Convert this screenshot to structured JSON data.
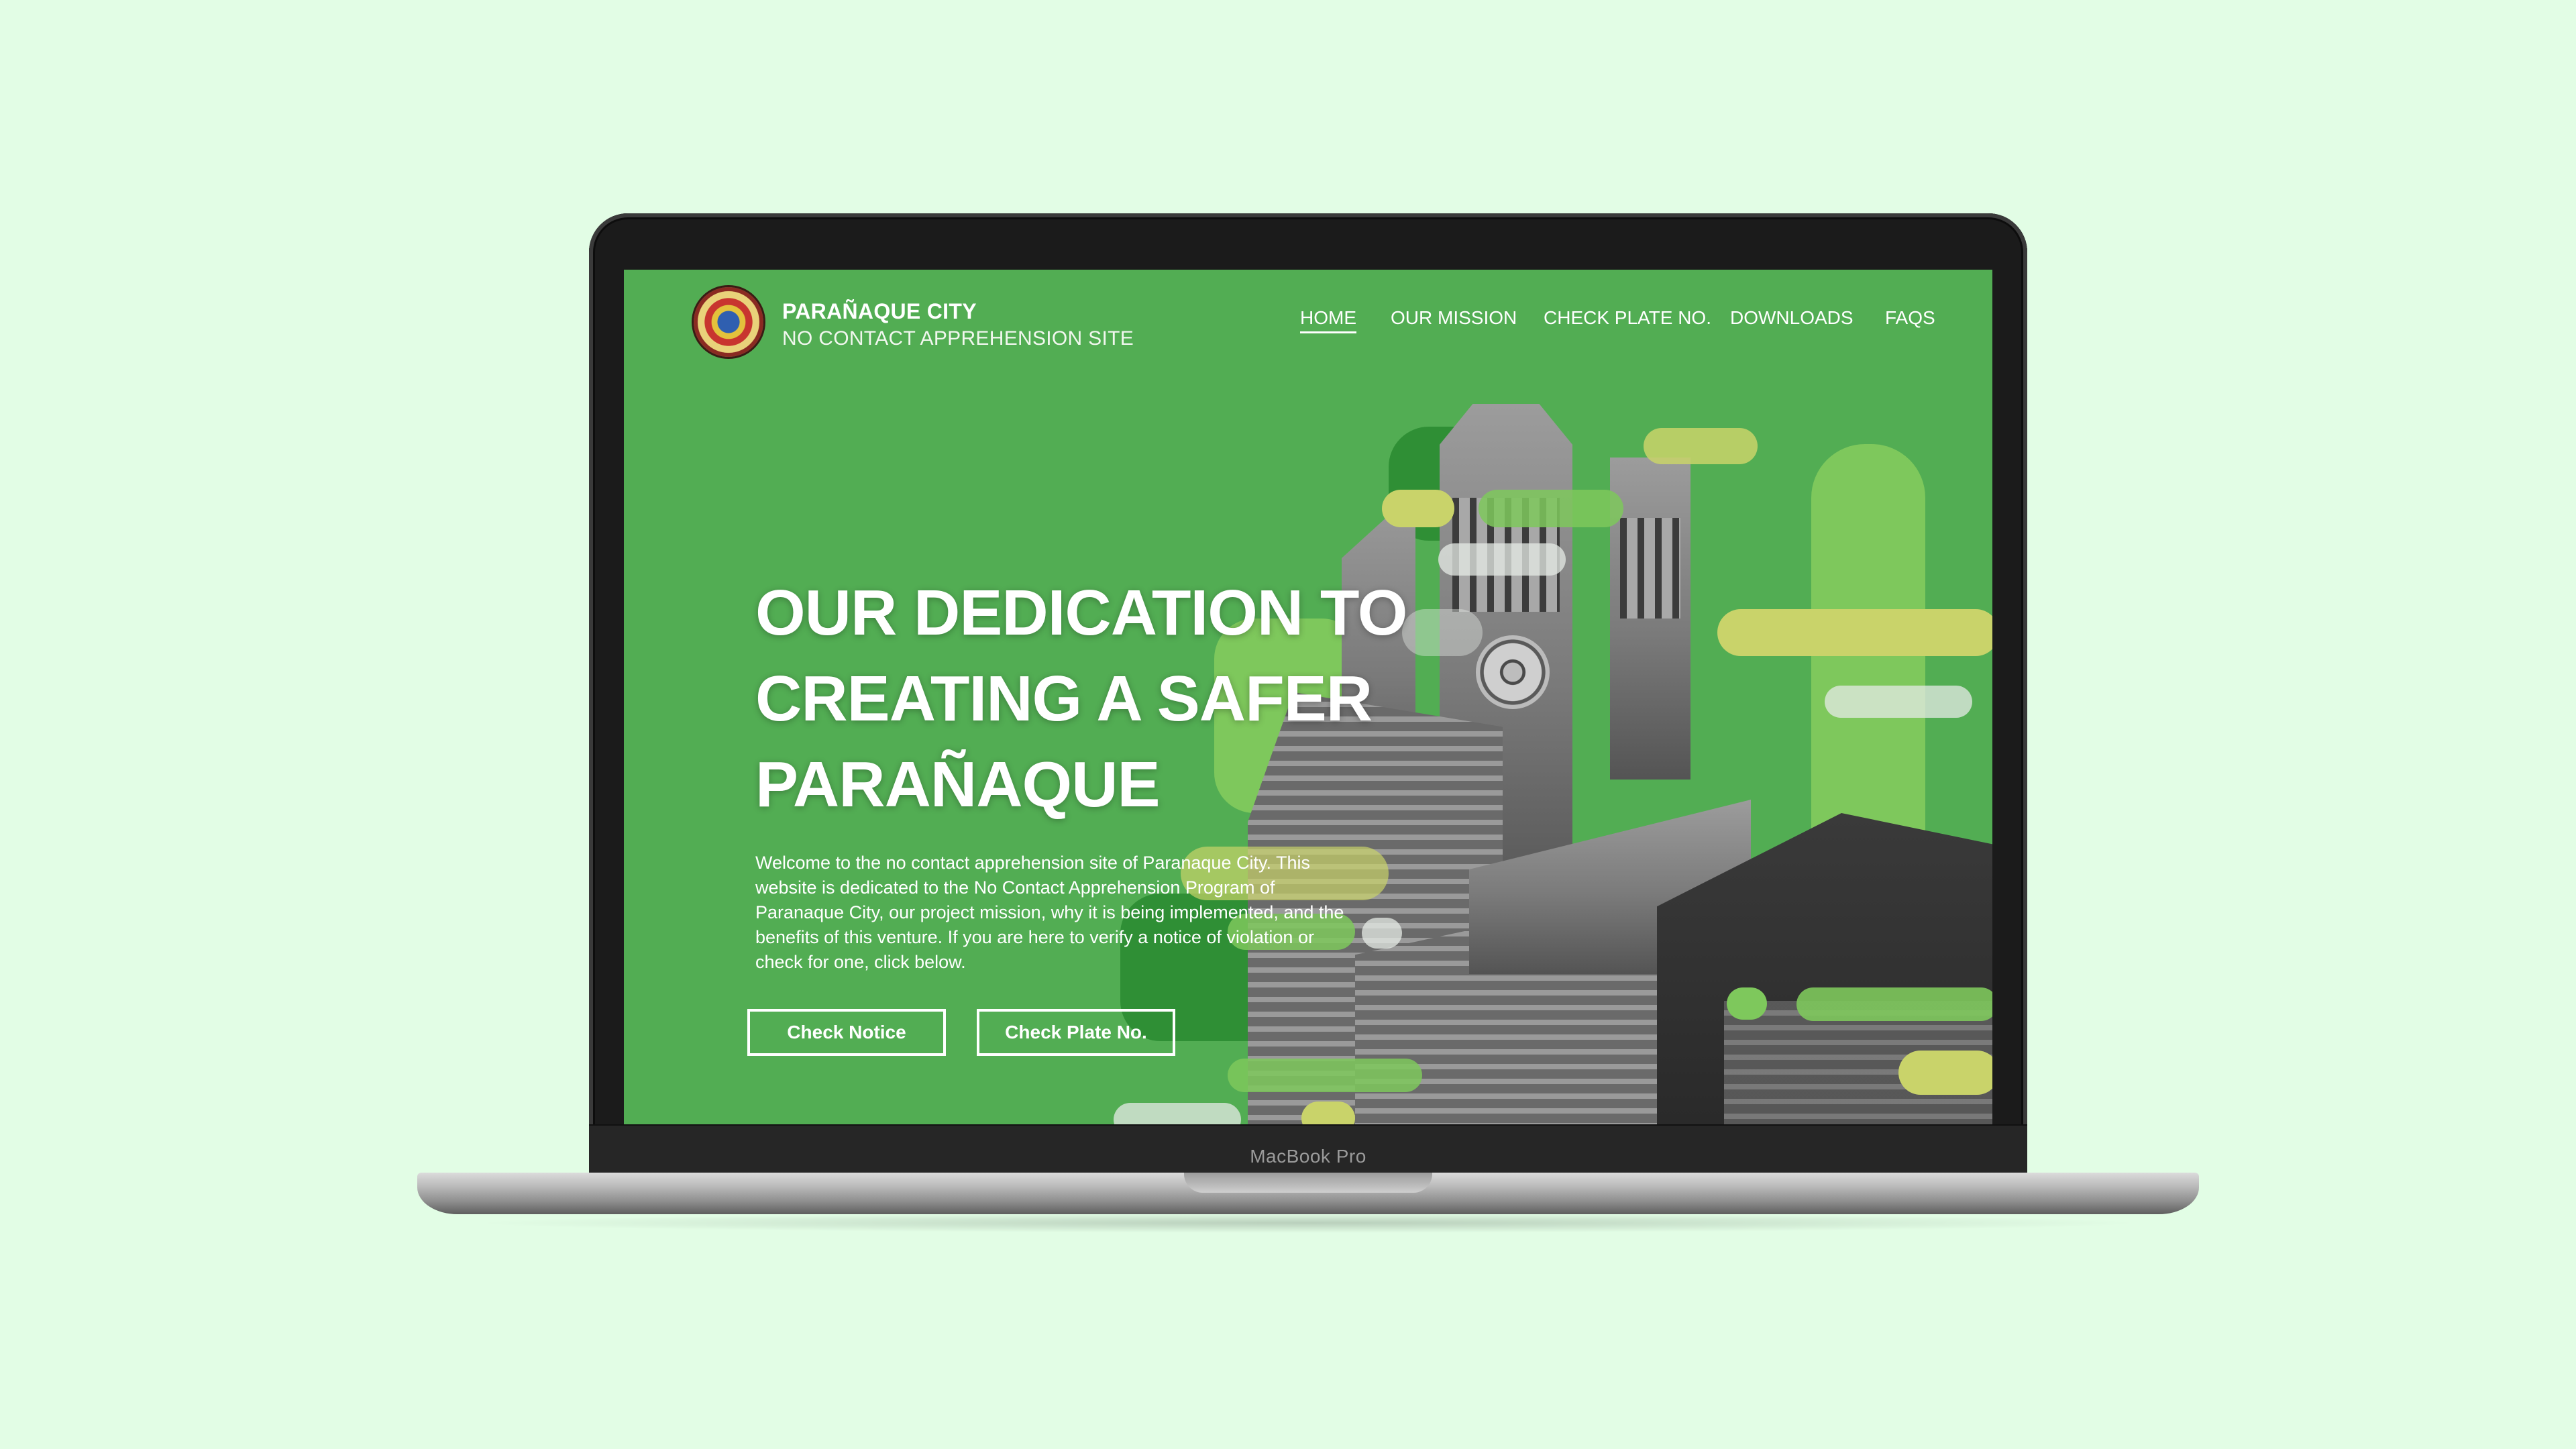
{
  "device": {
    "label": "MacBook Pro"
  },
  "header": {
    "title": "PARAÑAQUE CITY",
    "subtitle": "NO CONTACT APPREHENSION SITE",
    "nav": [
      {
        "label": "HOME",
        "active": true
      },
      {
        "label": "OUR MISSION",
        "active": false
      },
      {
        "label": "CHECK PLATE NO.",
        "active": false
      },
      {
        "label": "DOWNLOADS",
        "active": false
      },
      {
        "label": "FAQS",
        "active": false
      }
    ]
  },
  "hero": {
    "title_lines": [
      "OUR DEDICATION TO",
      "CREATING A SAFER",
      "PARAÑAQUE"
    ],
    "body": "Welcome to the no contact apprehension site of Paranaque City. This website is dedicated to the No Contact Apprehension Program of Paranaque City, our project mission, why it is being implemented, and the benefits of this venture.  If you are here to verify a notice of violation or check for one, click below.",
    "buttons": [
      {
        "label": "Check Notice"
      },
      {
        "label": "Check Plate No."
      }
    ]
  },
  "colors": {
    "page_background": "#e2fde5",
    "screen_green": "#52ad53",
    "dark_green": "#2f8f35",
    "light_green": "#7ec85c",
    "yellow_green": "#c9d36a"
  }
}
